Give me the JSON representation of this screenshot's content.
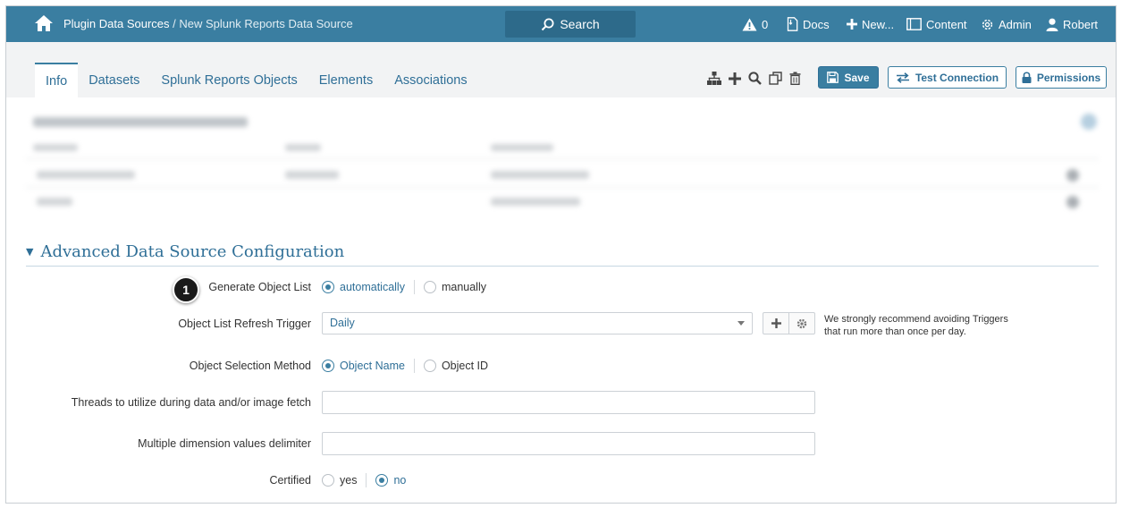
{
  "topbar": {
    "breadcrumb_root": "Plugin Data Sources",
    "breadcrumb_sep": "/",
    "breadcrumb_current": "New Splunk Reports Data Source",
    "search_label": "Search",
    "alerts_count": "0",
    "docs_label": "Docs",
    "new_label": "New...",
    "content_label": "Content",
    "admin_label": "Admin",
    "user_label": "Robert"
  },
  "tabs": [
    {
      "label": "Info",
      "active": true
    },
    {
      "label": "Datasets"
    },
    {
      "label": "Splunk Reports Objects"
    },
    {
      "label": "Elements"
    },
    {
      "label": "Associations"
    }
  ],
  "toolbar": {
    "icons": [
      "hierarchy-icon",
      "plus-icon",
      "search-icon",
      "copy-icon",
      "trash-icon"
    ],
    "save_label": "Save",
    "test_connection_label": "Test Connection",
    "permissions_label": "Permissions"
  },
  "section": {
    "title": "Advanced Data Source Configuration"
  },
  "form": {
    "generate_object_list": {
      "label": "Generate Object List",
      "options": [
        "automatically",
        "manually"
      ],
      "selected": "automatically"
    },
    "refresh_trigger": {
      "label": "Object List Refresh Trigger",
      "value": "Daily",
      "hint_line1": "We strongly recommend avoiding Triggers",
      "hint_line2": "that run more than once per day."
    },
    "selection_method": {
      "label": "Object Selection Method",
      "options": [
        "Object Name",
        "Object ID"
      ],
      "selected": "Object Name"
    },
    "threads": {
      "label": "Threads to utilize during data and/or image fetch",
      "value": ""
    },
    "delimiter": {
      "label": "Multiple dimension values delimiter",
      "value": ""
    },
    "certified": {
      "label": "Certified",
      "options": [
        "yes",
        "no"
      ],
      "selected": "no"
    }
  },
  "annotation": {
    "step_number": "1"
  },
  "colors": {
    "brand": "#3a7ea1",
    "link": "#2f6f97",
    "badge": "#1a1a1a"
  }
}
